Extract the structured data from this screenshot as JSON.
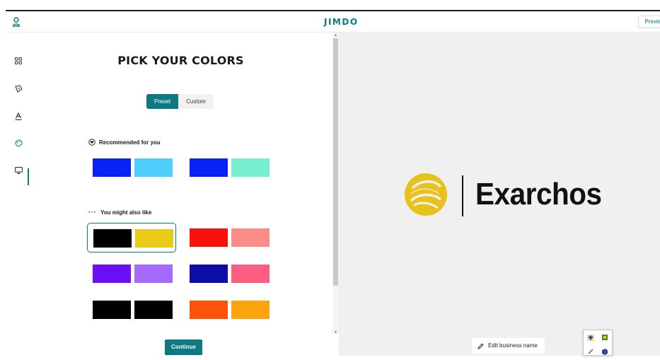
{
  "header": {
    "logo": "JIMDO",
    "preview_label": "Previe"
  },
  "sidebar": {
    "items": [
      {
        "name": "pages",
        "icon": "grid-icon"
      },
      {
        "name": "design",
        "icon": "brush-icon"
      },
      {
        "name": "fonts",
        "icon": "text-a-icon"
      },
      {
        "name": "colors",
        "icon": "palette-icon",
        "active": true
      },
      {
        "name": "preview-desktop",
        "icon": "monitor-icon"
      }
    ]
  },
  "panel": {
    "title": "PICK YOUR COLORS",
    "toggle": {
      "preset": "Preset",
      "custom": "Custom",
      "selected": "Preset"
    },
    "recommended_label": "Recommended for you",
    "might_like_label": "You might also like",
    "recommended": [
      {
        "a": "#0a21f5",
        "b": "#4fcffb"
      },
      {
        "a": "#0a21f5",
        "b": "#78eed0"
      }
    ],
    "suggestions": [
      {
        "a": "#000000",
        "b": "#e9cc1a",
        "selected": true
      },
      {
        "a": "#fd0f0b",
        "b": "#fb8c88"
      },
      {
        "a": "#6a10f6",
        "b": "#a56afb"
      },
      {
        "a": "#0c0ca6",
        "b": "#fb5e80"
      },
      {
        "a": "#000000",
        "b": "#000000"
      },
      {
        "a": "#fc520b",
        "b": "#fca40b"
      }
    ],
    "continue_label": "Continue"
  },
  "preview": {
    "brand_name": "Exarchos",
    "brand_color": "#e8c21c",
    "edit_label": "Edit business name"
  }
}
